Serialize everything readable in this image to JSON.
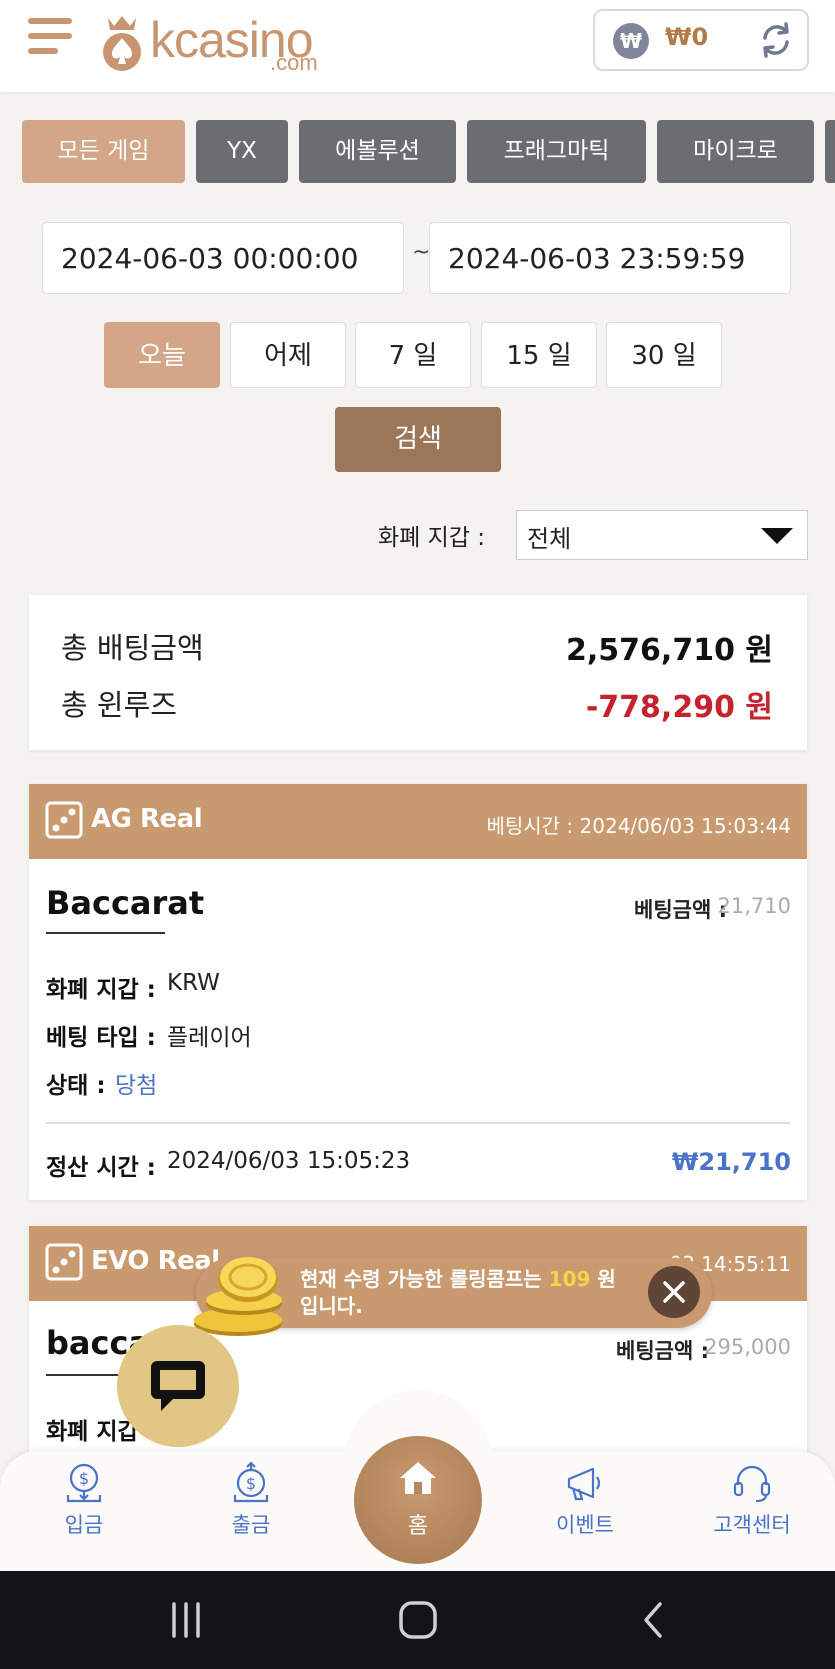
{
  "header": {
    "logo_text": "kcasino",
    "logo_domain": ".com",
    "balance_currency_badge": "₩",
    "balance_value": "₩0"
  },
  "game_tabs": [
    {
      "label": "모든 게임",
      "active": true
    },
    {
      "label": "YX"
    },
    {
      "label": "에볼루션"
    },
    {
      "label": "프래그마틱"
    },
    {
      "label": "마이크로"
    }
  ],
  "date_filter": {
    "start": "2024-06-03 00:00:00",
    "separator": "~",
    "end": "2024-06-03 23:59:59",
    "ranges": [
      {
        "label": "오늘",
        "active": true
      },
      {
        "label": "어제"
      },
      {
        "label": "7 일"
      },
      {
        "label": "15 일"
      },
      {
        "label": "30 일"
      }
    ],
    "search_label": "검색"
  },
  "wallet": {
    "label": "화폐 지갑 :",
    "selected": "전체"
  },
  "summary": {
    "total_bet_label": "총 배팅금액",
    "total_bet_value": "2,576,710 원",
    "total_winloss_label": "총 윈루즈",
    "total_winloss_value": "-778,290 원"
  },
  "bets": [
    {
      "provider": "AG Real",
      "bet_time_label": "베팅시간 :",
      "bet_time": "2024/06/03 15:03:44",
      "game": "Baccarat",
      "bet_amount_label": "베팅금액 :",
      "bet_amount": "21,710",
      "wallet_label": "화폐 지갑 :",
      "wallet_value": "KRW",
      "bet_type_label": "베팅 타입 :",
      "bet_type_value": "플레이어",
      "status_label": "상태 :",
      "status_value": "당첨",
      "settle_label": "정산 시간 :",
      "settle_time": "2024/06/03 15:05:23",
      "payout": "₩21,710"
    },
    {
      "provider": "EVO Real",
      "bet_time_tail": "03 14:55:11",
      "game_partial": "baccar",
      "bet_amount_label": "베팅금액 :",
      "bet_amount": "295,000",
      "wallet_label_partial": "화폐 지갑"
    }
  ],
  "toast": {
    "text_before": "현재 수령 가능한 롤링콤프는 ",
    "amount": "109",
    "text_after": " 원",
    "line2": "입니다."
  },
  "bottom_nav": [
    {
      "label": "입금",
      "icon": "deposit-icon"
    },
    {
      "label": "출금",
      "icon": "withdraw-icon"
    },
    {
      "label": "홈",
      "icon": "home-icon"
    },
    {
      "label": "이벤트",
      "icon": "megaphone-icon"
    },
    {
      "label": "고객센터",
      "icon": "headset-icon"
    }
  ],
  "colors": {
    "accent": "#c99a70",
    "tab_inactive": "#6c6c73",
    "negative": "#c4232e",
    "positive": "#4a72c8",
    "search": "#9b7659"
  }
}
